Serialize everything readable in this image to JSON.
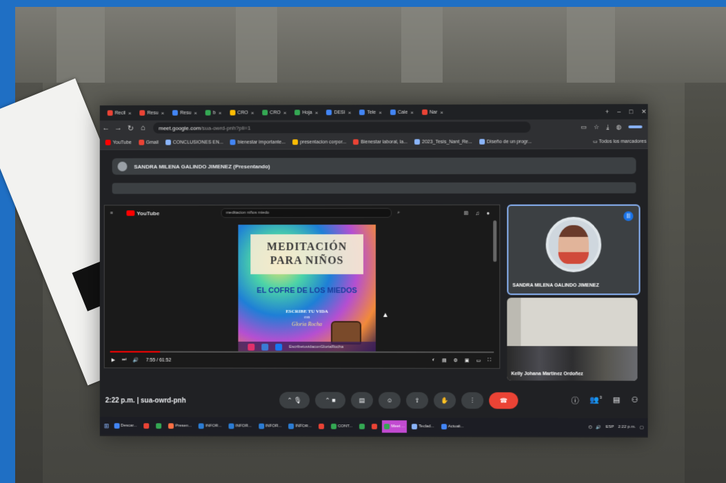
{
  "tabs": [
    {
      "label": "Recil",
      "color": "#ea4335"
    },
    {
      "label": "Resu",
      "color": "#ea4335"
    },
    {
      "label": "Resu",
      "color": "#4285f4"
    },
    {
      "label": "b",
      "color": "#34a853"
    },
    {
      "label": "CRO",
      "color": "#fbbc04"
    },
    {
      "label": "CRO",
      "color": "#34a853"
    },
    {
      "label": "Hoja",
      "color": "#34a853"
    },
    {
      "label": "DESI",
      "color": "#4285f4"
    },
    {
      "label": "Tele",
      "color": "#4285f4"
    },
    {
      "label": "Cale",
      "color": "#4285f4"
    },
    {
      "label": "Nar",
      "color": "#ea4335"
    }
  ],
  "url": {
    "domain": "meet.google.com",
    "path": "/sua-owrd-pnh?pli=1"
  },
  "account_pill": "",
  "bookmarks": [
    {
      "label": "YouTube",
      "color": "#ff0000"
    },
    {
      "label": "Gmail",
      "color": "#ea4335"
    },
    {
      "label": "CONCLUSIONES EN...",
      "color": "#8ab4f8"
    },
    {
      "label": "bienestar importante...",
      "color": "#4285f4"
    },
    {
      "label": "presentacion corpor...",
      "color": "#fbbc04"
    },
    {
      "label": "Bienestar laboral, la...",
      "color": "#ea4335"
    },
    {
      "label": "2023_Tesis_Nant_Re...",
      "color": "#8ab4f8"
    },
    {
      "label": "Diseño de un progr...",
      "color": "#8ab4f8"
    }
  ],
  "bookmarks_all": "Todos los marcadores",
  "presenter": "SANDRA MILENA GALINDO JIMENEZ (Presentando)",
  "youtube": {
    "logo": "YouTube",
    "search": "meditacion niños miedo",
    "time": "7:55 / 61:52",
    "progress": 0.13
  },
  "video": {
    "title_line1": "MEDITACIÓN",
    "title_line2": "PARA NIÑOS",
    "subtitle": "EL COFRE DE LOS MIEDOS",
    "tagline": "ESCRIBE TU VIDA",
    "tagline2": "con",
    "author": "Gloria Rocha",
    "social": "EscribetuvidaconGloriaRocha"
  },
  "participants": [
    {
      "name": "SANDRA MILENA GALINDO JIMENEZ"
    },
    {
      "name": "Kelly Johana Martinez Ordoñez"
    }
  ],
  "meeting": {
    "time": "2:22 p.m.",
    "code": "sua-owrd-pnh",
    "people_count": "3"
  },
  "taskbar": [
    {
      "label": "Descar...",
      "color": "#4285f4",
      "active": false
    },
    {
      "label": "",
      "color": "#ea4335",
      "active": false
    },
    {
      "label": "",
      "color": "#34a853",
      "active": false
    },
    {
      "label": "Presen...",
      "color": "#ff7043",
      "active": false
    },
    {
      "label": "INFOR...",
      "color": "#2b7cd3",
      "active": false
    },
    {
      "label": "INFOR...",
      "color": "#2b7cd3",
      "active": false
    },
    {
      "label": "INFOR...",
      "color": "#2b7cd3",
      "active": false
    },
    {
      "label": "INFOR...",
      "color": "#2b7cd3",
      "active": false
    },
    {
      "label": "",
      "color": "#ea4335",
      "active": false
    },
    {
      "label": "CONT...",
      "color": "#34a853",
      "active": false
    },
    {
      "label": "",
      "color": "#34a853",
      "active": false
    },
    {
      "label": "",
      "color": "#ea4335",
      "active": false
    },
    {
      "label": "Meet ...",
      "color": "#34a853",
      "active": true
    },
    {
      "label": "Teclad...",
      "color": "#8ab4f8",
      "active": false
    },
    {
      "label": "Actuali...",
      "color": "#4285f4",
      "active": false
    }
  ],
  "tray": {
    "lang": "ESP",
    "clock": "2:22 p.m."
  }
}
